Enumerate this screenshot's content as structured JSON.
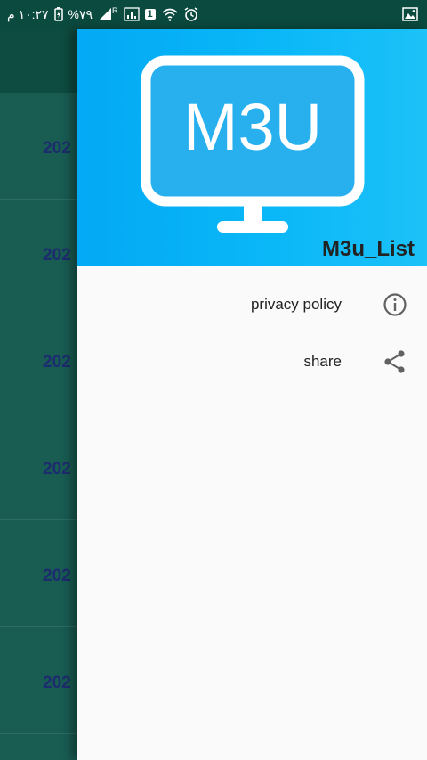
{
  "status_bar": {
    "time": "١٠:٢٧ م",
    "battery": "%٧٩",
    "sim_label": "1",
    "roaming": "R"
  },
  "background_list": {
    "rows": [
      "202",
      "202",
      "202",
      "202",
      "202",
      "202"
    ]
  },
  "drawer": {
    "logo_text": "M3U",
    "header_title": "M3u_List",
    "items": [
      {
        "label": "privacy policy",
        "icon": "info-icon"
      },
      {
        "label": "share",
        "icon": "share-icon"
      }
    ]
  },
  "colors": {
    "status_bar": "#0b4a3f",
    "toolbar": "#0e4b40",
    "list_bg": "#185c52",
    "header_blue": "#03a9f4",
    "drawer_bg": "#fafafa",
    "row_text": "#1d2c6e"
  }
}
